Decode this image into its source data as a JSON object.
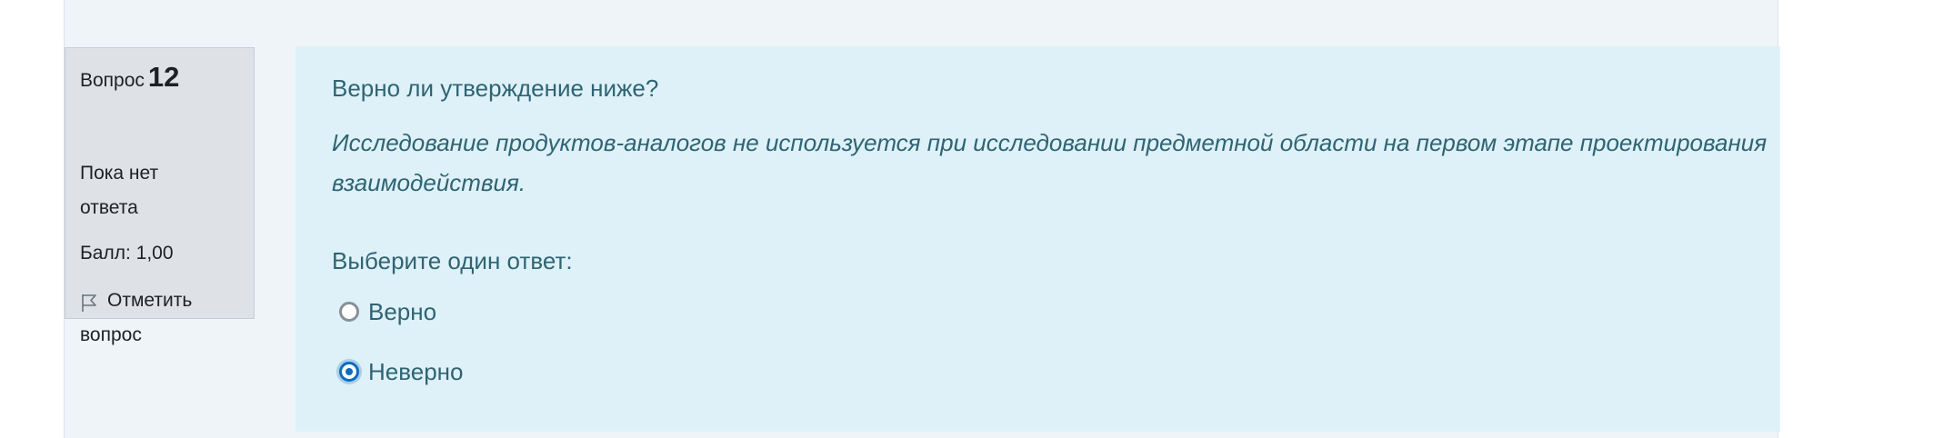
{
  "question_info": {
    "label": "Вопрос",
    "number": "12",
    "state_line1": "Пока нет",
    "state_line2": "ответа",
    "grade": "Балл: 1,00",
    "flag_line1": "Отметить",
    "flag_line2": "вопрос"
  },
  "question": {
    "head": "Верно ли утверждение ниже?",
    "body": "Исследование продуктов-аналогов не используется при исследовании предметной области на первом этапе проектирования взаимодействия.",
    "prompt": "Выберите один ответ:",
    "options": [
      {
        "label": "Верно",
        "selected": false
      },
      {
        "label": "Неверно",
        "selected": true
      }
    ]
  },
  "colors": {
    "info_bg": "#dee2e6",
    "formulation_bg": "#def1f8",
    "question_text": "#2f6473",
    "radio_selected": "#0f6cbf"
  },
  "icons": {
    "flag": "flag-icon",
    "radio_unchecked": "radio-unchecked-icon",
    "radio_checked": "radio-checked-icon"
  }
}
